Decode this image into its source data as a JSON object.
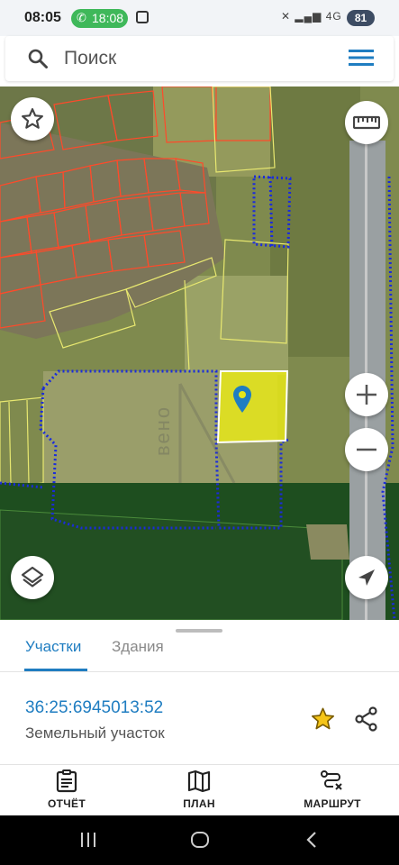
{
  "status_bar": {
    "time": "08:05",
    "call_timer": "18:08",
    "network": "4G",
    "battery": "81"
  },
  "search": {
    "placeholder": "Поиск"
  },
  "map": {
    "watermark": "вено"
  },
  "tabs": [
    {
      "label": "Участки",
      "active": true
    },
    {
      "label": "Здания",
      "active": false
    }
  ],
  "parcel": {
    "cadastral_number": "36:25:6945013:52",
    "type": "Земельный участок"
  },
  "bottom_nav": [
    {
      "label": "ОТЧЁТ",
      "icon": "report-icon"
    },
    {
      "label": "ПЛАН",
      "icon": "map-plan-icon"
    },
    {
      "label": "МАРШРУТ",
      "icon": "route-icon"
    }
  ],
  "colors": {
    "accent": "#1f7dc1",
    "selected_parcel": "#e6e619",
    "parcel_outline_red": "#ff4a2a",
    "parcel_outline_blue_dotted": "#1a2bdc",
    "call_green": "#3fb85a"
  }
}
